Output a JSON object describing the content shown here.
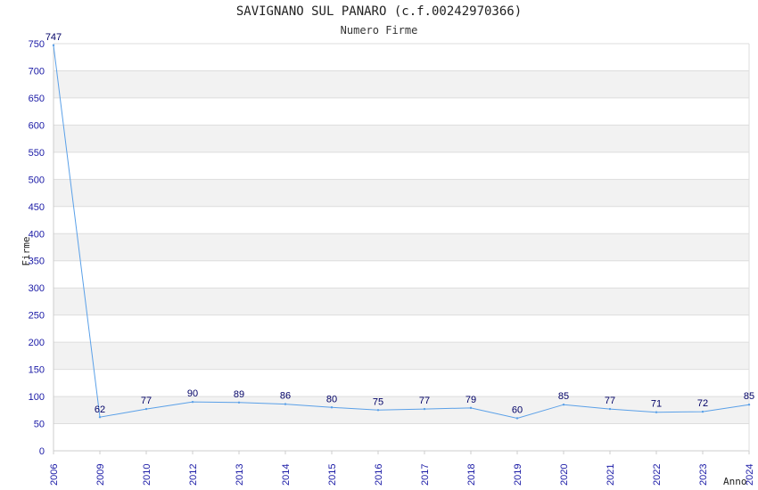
{
  "chart_data": {
    "type": "line",
    "title": "SAVIGNANO SUL PANARO (c.f.00242970366)",
    "subtitle": "Numero Firme",
    "xlabel": "Anno",
    "ylabel": "Firme",
    "x": [
      "2006",
      "2009",
      "2010",
      "2012",
      "2013",
      "2014",
      "2015",
      "2016",
      "2017",
      "2018",
      "2019",
      "2020",
      "2021",
      "2022",
      "2023",
      "2024"
    ],
    "values": [
      747,
      62,
      77,
      90,
      89,
      86,
      80,
      75,
      77,
      79,
      60,
      85,
      77,
      71,
      72,
      85
    ],
    "ylim": [
      0,
      750
    ],
    "yticks": [
      "0",
      "50",
      "100",
      "150",
      "200",
      "250",
      "300",
      "350",
      "400",
      "450",
      "500",
      "550",
      "600",
      "650",
      "700",
      "750"
    ],
    "grid": true,
    "colors": {
      "line": "#5aa0e8",
      "band": "#f2f2f2",
      "grid": "#dddddd",
      "ticks": "#1a1aa6",
      "labels": "#000066"
    }
  }
}
